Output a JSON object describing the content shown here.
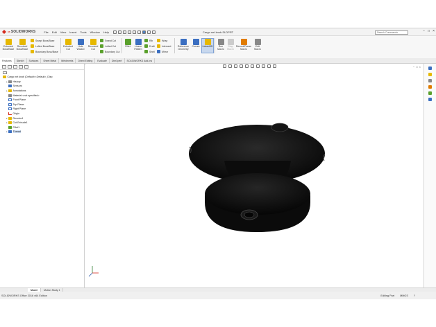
{
  "app": {
    "logo_prefix": "3S",
    "logo_text": "SOLIDWORKS",
    "menu": [
      "File",
      "Edit",
      "View",
      "Insert",
      "Tools",
      "Window",
      "Help"
    ],
    "document_title": "Cargo net knob.SLDPRT",
    "search_placeholder": "Search Commands",
    "window_controls": [
      "−",
      "□",
      "×"
    ]
  },
  "commands": {
    "extruded_boss": "Extruded Boss/Base",
    "revolved_boss": "Revolved Boss/Base",
    "swept_boss": "Swept Boss/Base",
    "lofted_boss": "Lofted Boss/Base",
    "boundary_boss": "Boundary Boss/Base",
    "extruded_cut": "Extruded Cut",
    "hole_wizard": "Hole Wizard",
    "revolved_cut": "Revolved Cut",
    "swept_cut": "Swept Cut",
    "lofted_cut": "Lofted Cut",
    "boundary_cut": "Boundary Cut",
    "fillet": "Fillet",
    "linear_pattern": "Linear Pattern",
    "rib": "Rib",
    "draft": "Draft",
    "shell": "Shell",
    "wrap": "Wrap",
    "intersect": "Intersect",
    "mirror": "Mirror",
    "reference_geometry": "Reference Geometry",
    "curves": "Curves",
    "instant3d": "Instant3D",
    "run_macro": "Run Macro",
    "stop_macro": "Stop Macro",
    "record_macro": "Record/Pause Macro",
    "edit_macro": "Edit Macro"
  },
  "command_tabs": [
    "Features",
    "Sketch",
    "Surfaces",
    "Sheet Metal",
    "Weldments",
    "Direct Editing",
    "Evaluate",
    "DimXpert",
    "SOLIDWORKS Add-Ins"
  ],
  "tree": {
    "root": "Cargo net knob  (Default<<Default>_Disp",
    "items": [
      {
        "label": "History",
        "expand": "▸"
      },
      {
        "label": "Sensors",
        "expand": ""
      },
      {
        "label": "Annotations",
        "expand": "▸"
      },
      {
        "label": "Material <not specified>",
        "expand": ""
      },
      {
        "label": "Front Plane",
        "expand": ""
      },
      {
        "label": "Top Plane",
        "expand": ""
      },
      {
        "label": "Right Plane",
        "expand": ""
      },
      {
        "label": "Origin",
        "expand": ""
      },
      {
        "label": "Revolve1",
        "expand": "▸"
      },
      {
        "label": "Cut-Extrude1",
        "expand": "▸"
      },
      {
        "label": "Fillet1",
        "expand": ""
      },
      {
        "label": "Thread",
        "expand": "▸"
      }
    ]
  },
  "bottom_tabs": [
    "Model",
    "Motion Study 1"
  ],
  "status": {
    "edition": "SOLIDWORKS Office 2016 x64 Edition",
    "mode": "Editing Part",
    "units": "MMGS",
    "help": "?"
  },
  "colors": {
    "accent": "#d52b1e",
    "selection": "#cfe0f7",
    "model": "#111111"
  }
}
